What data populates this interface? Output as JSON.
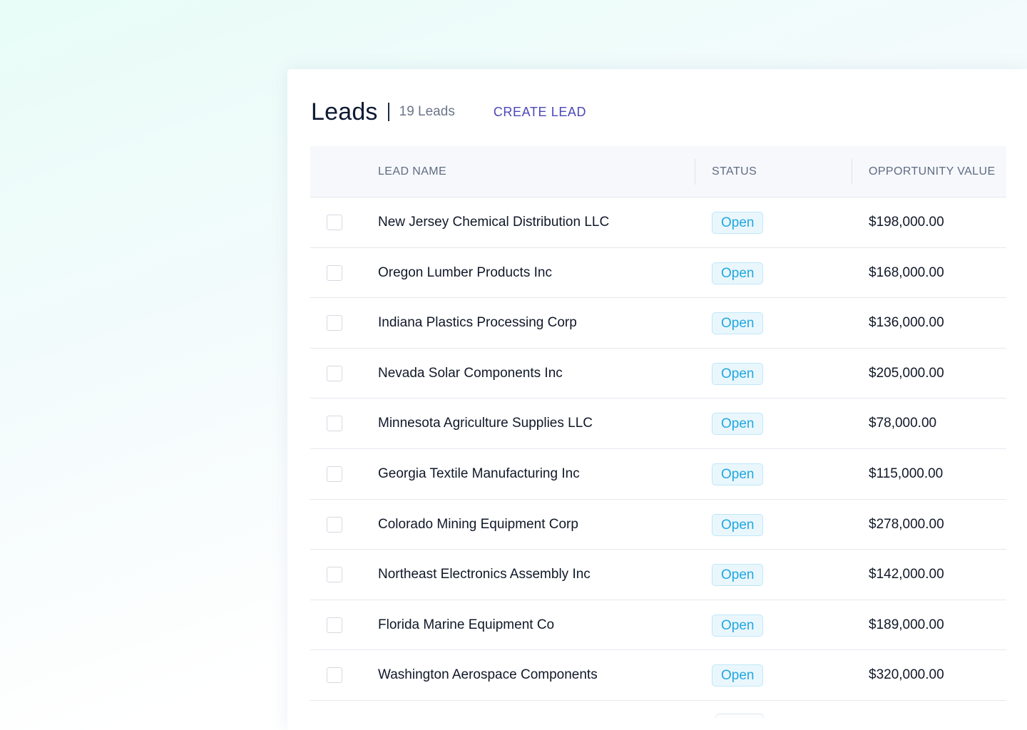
{
  "header": {
    "title": "Leads",
    "count_label": "19 Leads",
    "create_label": "CREATE LEAD"
  },
  "table": {
    "columns": {
      "lead_name": "LEAD NAME",
      "status": "STATUS",
      "opportunity_value": "OPPORTUNITY VALUE"
    },
    "rows": [
      {
        "name": "New Jersey Chemical Distribution LLC",
        "status": "Open",
        "value": "$198,000.00"
      },
      {
        "name": "Oregon Lumber Products Inc",
        "status": "Open",
        "value": "$168,000.00"
      },
      {
        "name": "Indiana Plastics Processing Corp",
        "status": "Open",
        "value": "$136,000.00"
      },
      {
        "name": "Nevada Solar Components Inc",
        "status": "Open",
        "value": "$205,000.00"
      },
      {
        "name": "Minnesota Agriculture Supplies LLC",
        "status": "Open",
        "value": "$78,000.00"
      },
      {
        "name": "Georgia Textile Manufacturing Inc",
        "status": "Open",
        "value": "$115,000.00"
      },
      {
        "name": "Colorado Mining Equipment Corp",
        "status": "Open",
        "value": "$278,000.00"
      },
      {
        "name": "Northeast Electronics Assembly Inc",
        "status": "Open",
        "value": "$142,000.00"
      },
      {
        "name": "Florida Marine Equipment Co",
        "status": "Open",
        "value": "$189,000.00"
      },
      {
        "name": "Washington Aerospace Components",
        "status": "Open",
        "value": "$320,000.00"
      }
    ]
  },
  "colors": {
    "accent_link": "#4b48b7",
    "status_open_text": "#22a7df",
    "status_open_bg": "#e9f7fd",
    "background_tint": "#e8fdf7"
  }
}
